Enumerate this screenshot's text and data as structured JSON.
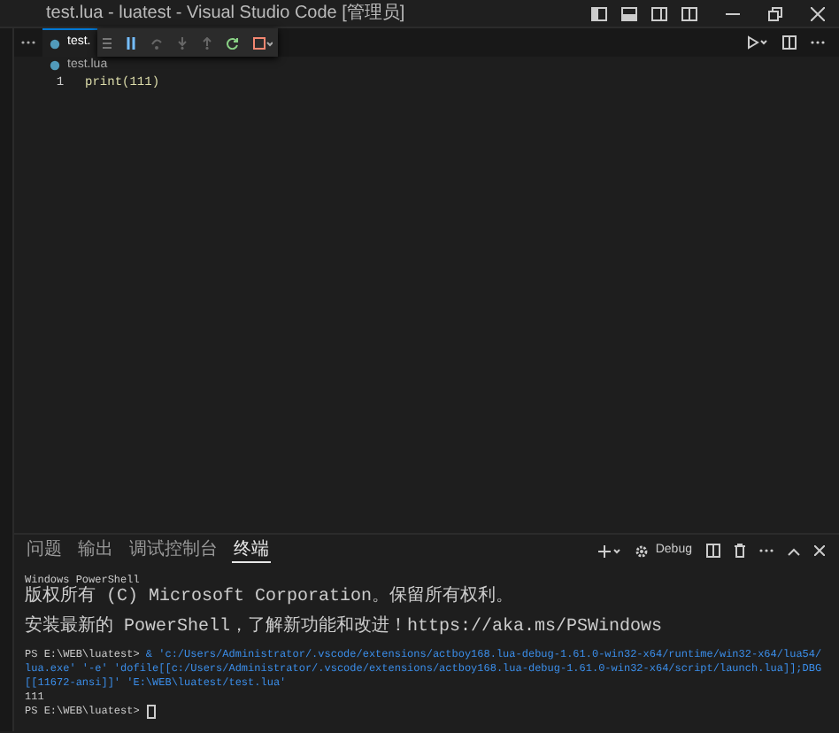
{
  "window": {
    "title": "test.lua - luatest - Visual Studio Code [管理员]"
  },
  "editor_tabs": [
    {
      "label": "test.",
      "selected": true
    }
  ],
  "breadcrumb": "test.lua",
  "code_lines": [
    {
      "number": "1",
      "text": "print(111)"
    }
  ],
  "panel": {
    "tabs": [
      {
        "label": "问题",
        "selected": false
      },
      {
        "label": "输出",
        "selected": false
      },
      {
        "label": "调试控制台",
        "selected": false
      },
      {
        "label": "终端",
        "selected": true
      }
    ],
    "run_config": "Debug"
  },
  "terminal": {
    "lines": [
      {
        "kind": "plain",
        "text": "Windows PowerShell"
      },
      {
        "kind": "plain",
        "text": "版权所有 (C) Microsoft Corporation。保留所有权利。"
      },
      {
        "kind": "spaced",
        "text": "安装最新的 PowerShell，了解新功能和改进！https://aka.ms/PSWindows"
      },
      {
        "kind": "command",
        "prompt": "PS E:\\WEB\\luatest>",
        "text": "& 'c:/Users/Administrator/.vscode/extensions/actboy168.lua-debug-1.61.0-win32-x64/runtime/win32-x64/lua54/lua.exe' '-e' 'dofile[[c:/Users/Administrator/.vscode/extensions/actboy168.lua-debug-1.61.0-win32-x64/script/launch.lua]];DBG[[11672-ansi]]' 'E:\\WEB\\luatest/test.lua'"
      },
      {
        "kind": "plain",
        "text": "111"
      },
      {
        "kind": "prompt",
        "prompt": "PS E:\\WEB\\luatest>"
      }
    ]
  }
}
